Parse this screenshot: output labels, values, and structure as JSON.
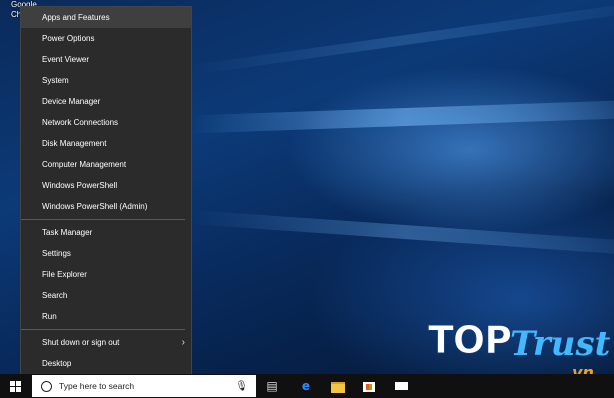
{
  "desktop": {
    "icon_label_line1": "Google",
    "icon_label_line2": "Ch"
  },
  "menu": {
    "group1": [
      {
        "label": "Apps and Features",
        "selected": true
      },
      {
        "label": "Power Options"
      },
      {
        "label": "Event Viewer"
      },
      {
        "label": "System"
      },
      {
        "label": "Device Manager"
      },
      {
        "label": "Network Connections"
      },
      {
        "label": "Disk Management"
      },
      {
        "label": "Computer Management"
      },
      {
        "label": "Windows PowerShell"
      },
      {
        "label": "Windows PowerShell (Admin)"
      }
    ],
    "group2": [
      {
        "label": "Task Manager"
      },
      {
        "label": "Settings"
      },
      {
        "label": "File Explorer"
      },
      {
        "label": "Search"
      },
      {
        "label": "Run"
      }
    ],
    "group3": [
      {
        "label": "Shut down or sign out",
        "submenu_icon": "chevron-right-icon"
      },
      {
        "label": "Desktop"
      }
    ]
  },
  "taskbar": {
    "search_placeholder": "Type here to search",
    "icons": [
      "windows-logo-icon",
      "cortana-circle-icon",
      "microphone-icon",
      "task-view-icon",
      "edge-icon",
      "file-explorer-icon",
      "store-icon",
      "mail-icon"
    ]
  },
  "watermark": {
    "part1": "TOP",
    "part2": "Trust",
    "suffix": ".vn"
  },
  "colors": {
    "menu_bg": "#2b2b2b",
    "menu_selected": "#3f3f3f",
    "taskbar_bg": "#101010",
    "edge_blue": "#2d8cff",
    "watermark_blue": "#41b8ff",
    "watermark_orange": "#f0a020"
  }
}
